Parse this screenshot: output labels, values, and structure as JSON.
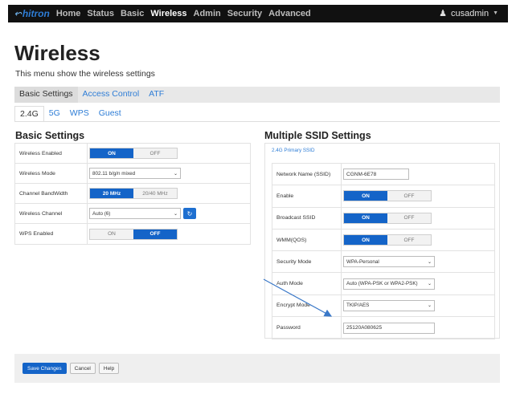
{
  "header": {
    "brand": "hitron",
    "nav": [
      "Home",
      "Status",
      "Basic",
      "Wireless",
      "Admin",
      "Security",
      "Advanced"
    ],
    "active_nav": "Wireless",
    "user": "cusadmin"
  },
  "page": {
    "title": "Wireless",
    "subtitle": "This menu show the wireless settings"
  },
  "tabs": [
    "Basic Settings",
    "Access Control",
    "ATF"
  ],
  "subtabs": [
    "2.4G",
    "5G",
    "WPS",
    "Guest"
  ],
  "basic": {
    "heading": "Basic Settings",
    "rows": [
      {
        "label": "Wireless Enabled",
        "on": "ON",
        "off": "OFF"
      },
      {
        "label": "Wireless Mode",
        "value": "802.11 b/g/n mixed"
      },
      {
        "label": "Channel BandWidth",
        "opt1": "20 MHz",
        "opt2": "20/40 MHz"
      },
      {
        "label": "Wireless Channel",
        "value": "Auto (6)"
      },
      {
        "label": "WPS Enabled",
        "on": "ON",
        "off": "OFF"
      }
    ]
  },
  "ssid": {
    "heading": "Multiple SSID Settings",
    "link": "2.4G Primary SSID",
    "rows": [
      {
        "label": "Network Name (SSID)",
        "value": "CGNM-6E78"
      },
      {
        "label": "Enable",
        "on": "ON",
        "off": "OFF"
      },
      {
        "label": "Broadcast SSID",
        "on": "ON",
        "off": "OFF"
      },
      {
        "label": "WMM(QOS)",
        "on": "ON",
        "off": "OFF"
      },
      {
        "label": "Security Mode",
        "value": "WPA-Personal"
      },
      {
        "label": "Auth Mode",
        "value": "Auto (WPA-PSK or WPA2-PSK)"
      },
      {
        "label": "Encrypt Mode",
        "value": "TKIP/AES"
      },
      {
        "label": "Password",
        "value": "25120A080625"
      }
    ]
  },
  "footer": {
    "save": "Save Changes",
    "cancel": "Cancel",
    "help": "Help"
  },
  "colors": {
    "accent": "#1464c8",
    "link": "#2e7dd6",
    "annotation_arrow": "#3a78c8"
  }
}
